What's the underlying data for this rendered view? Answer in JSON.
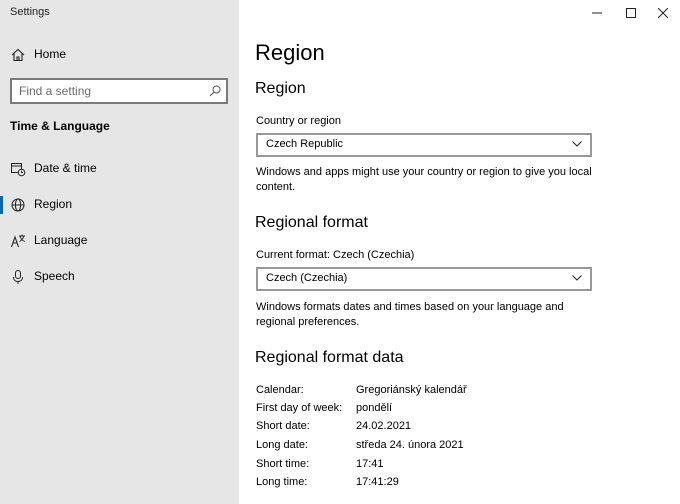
{
  "window": {
    "title": "Settings"
  },
  "sidebar": {
    "home": "Home",
    "search_placeholder": "Find a setting",
    "section_title": "Time & Language",
    "items": [
      {
        "label": "Date & time",
        "icon": "calendar-clock-icon"
      },
      {
        "label": "Region",
        "icon": "globe-icon",
        "active": true
      },
      {
        "label": "Language",
        "icon": "language-icon"
      },
      {
        "label": "Speech",
        "icon": "microphone-icon"
      }
    ]
  },
  "main": {
    "title": "Region",
    "region": {
      "heading": "Region",
      "country_label": "Country or region",
      "country_value": "Czech Republic",
      "description": "Windows and apps might use your country or region to give you local content."
    },
    "format": {
      "heading": "Regional format",
      "current_label": "Current format: Czech (Czechia)",
      "value": "Czech (Czechia)",
      "description": "Windows formats dates and times based on your language and regional preferences."
    },
    "format_data": {
      "heading": "Regional format data",
      "rows": [
        {
          "key": "Calendar:",
          "value": "Gregoriánský kalendář"
        },
        {
          "key": "First day of week:",
          "value": "pondělí"
        },
        {
          "key": "Short date:",
          "value": "24.02.2021"
        },
        {
          "key": "Long date:",
          "value": "středa 24. února 2021"
        },
        {
          "key": "Short time:",
          "value": "17:41"
        },
        {
          "key": "Long time:",
          "value": "17:41:29"
        }
      ]
    }
  },
  "colors": {
    "accent": "#0067c0",
    "sidebar_bg": "#e6e6e6"
  }
}
